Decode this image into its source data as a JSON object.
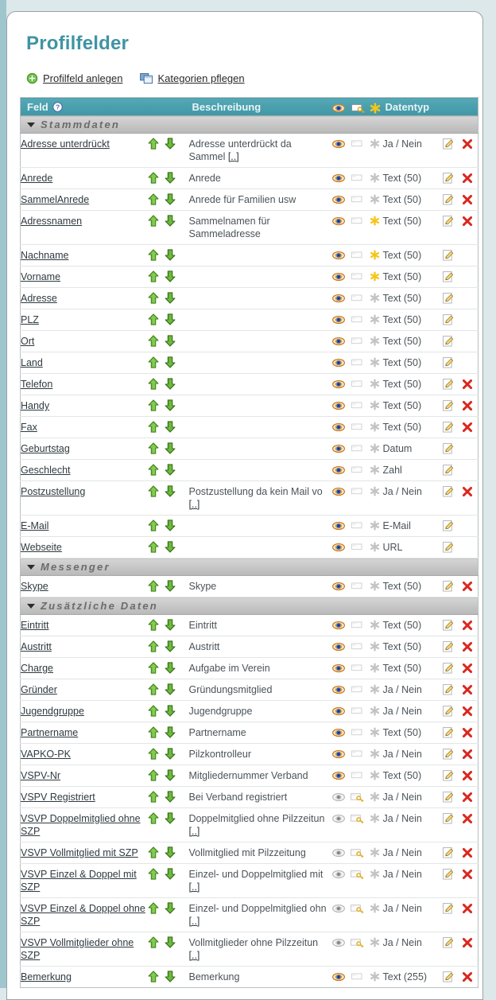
{
  "page": {
    "title": "Profilfelder"
  },
  "actions": [
    {
      "label": "Profilfeld anlegen",
      "icon": "plus-circle-icon"
    },
    {
      "label": "Kategorien pflegen",
      "icon": "categories-icon"
    }
  ],
  "table": {
    "headers": {
      "field": "Feld",
      "help_icon": "help-icon",
      "description": "Beschreibung",
      "visible_icon": "eye-icon",
      "protected_icon": "key-card-icon",
      "required_icon": "asterisk-icon",
      "datatype": "Datentyp"
    },
    "sections": [
      {
        "name": "Stammdaten",
        "rows": [
          {
            "field": "Adresse unterdrückt",
            "description": "Adresse unterdrückt da Sammel",
            "truncated": true,
            "eye": "on",
            "card": "empty",
            "required": false,
            "datatype": "Ja / Nein",
            "edit": true,
            "delete": true
          },
          {
            "field": "Anrede",
            "description": "Anrede",
            "truncated": false,
            "eye": "on",
            "card": "empty",
            "required": false,
            "datatype": "Text (50)",
            "edit": true,
            "delete": true
          },
          {
            "field": "SammelAnrede",
            "description": "Anrede für Familien usw",
            "truncated": false,
            "eye": "on",
            "card": "empty",
            "required": false,
            "datatype": "Text (50)",
            "edit": true,
            "delete": true
          },
          {
            "field": "Adressnamen",
            "description": "Sammelnamen für Sammeladresse",
            "truncated": false,
            "eye": "on",
            "card": "empty",
            "required": true,
            "datatype": "Text (50)",
            "edit": true,
            "delete": true
          },
          {
            "field": "Nachname",
            "description": "",
            "truncated": false,
            "eye": "on",
            "card": "empty",
            "required": true,
            "datatype": "Text (50)",
            "edit": true,
            "delete": false
          },
          {
            "field": "Vorname",
            "description": "",
            "truncated": false,
            "eye": "on",
            "card": "empty",
            "required": true,
            "datatype": "Text (50)",
            "edit": true,
            "delete": false
          },
          {
            "field": "Adresse",
            "description": "",
            "truncated": false,
            "eye": "on",
            "card": "empty",
            "required": false,
            "datatype": "Text (50)",
            "edit": true,
            "delete": false
          },
          {
            "field": "PLZ",
            "description": "",
            "truncated": false,
            "eye": "on",
            "card": "empty",
            "required": false,
            "datatype": "Text (50)",
            "edit": true,
            "delete": false
          },
          {
            "field": "Ort",
            "description": "",
            "truncated": false,
            "eye": "on",
            "card": "empty",
            "required": false,
            "datatype": "Text (50)",
            "edit": true,
            "delete": false
          },
          {
            "field": "Land",
            "description": "",
            "truncated": false,
            "eye": "on",
            "card": "empty",
            "required": false,
            "datatype": "Text (50)",
            "edit": true,
            "delete": false
          },
          {
            "field": "Telefon",
            "description": "",
            "truncated": false,
            "eye": "on",
            "card": "empty",
            "required": false,
            "datatype": "Text (50)",
            "edit": true,
            "delete": true
          },
          {
            "field": "Handy",
            "description": "",
            "truncated": false,
            "eye": "on",
            "card": "empty",
            "required": false,
            "datatype": "Text (50)",
            "edit": true,
            "delete": true
          },
          {
            "field": "Fax",
            "description": "",
            "truncated": false,
            "eye": "on",
            "card": "empty",
            "required": false,
            "datatype": "Text (50)",
            "edit": true,
            "delete": true
          },
          {
            "field": "Geburtstag",
            "description": "",
            "truncated": false,
            "eye": "on",
            "card": "empty",
            "required": false,
            "datatype": "Datum",
            "edit": true,
            "delete": false
          },
          {
            "field": "Geschlecht",
            "description": "",
            "truncated": false,
            "eye": "on",
            "card": "empty",
            "required": false,
            "datatype": "Zahl",
            "edit": true,
            "delete": false
          },
          {
            "field": "Postzustellung",
            "description": "Postzustellung da kein Mail vo",
            "truncated": true,
            "eye": "on",
            "card": "empty",
            "required": false,
            "datatype": "Ja / Nein",
            "edit": true,
            "delete": true
          },
          {
            "field": "E-Mail",
            "description": "",
            "truncated": false,
            "eye": "on",
            "card": "empty",
            "required": false,
            "datatype": "E-Mail",
            "edit": true,
            "delete": false
          },
          {
            "field": "Webseite",
            "description": "",
            "truncated": false,
            "eye": "on",
            "card": "empty",
            "required": false,
            "datatype": "URL",
            "edit": true,
            "delete": false
          }
        ]
      },
      {
        "name": "Messenger",
        "rows": [
          {
            "field": "Skype",
            "description": "Skype",
            "truncated": false,
            "eye": "on",
            "card": "empty",
            "required": false,
            "datatype": "Text (50)",
            "edit": true,
            "delete": true
          }
        ]
      },
      {
        "name": "Zusätzliche Daten",
        "rows": [
          {
            "field": "Eintritt",
            "description": "Eintritt",
            "truncated": false,
            "eye": "on",
            "card": "empty",
            "required": false,
            "datatype": "Text (50)",
            "edit": true,
            "delete": true
          },
          {
            "field": "Austritt",
            "description": "Austritt",
            "truncated": false,
            "eye": "on",
            "card": "empty",
            "required": false,
            "datatype": "Text (50)",
            "edit": true,
            "delete": true
          },
          {
            "field": "Charge",
            "description": "Aufgabe im Verein",
            "truncated": false,
            "eye": "on",
            "card": "empty",
            "required": false,
            "datatype": "Text (50)",
            "edit": true,
            "delete": true
          },
          {
            "field": "Gründer",
            "description": "Gründungsmitglied",
            "truncated": false,
            "eye": "on",
            "card": "empty",
            "required": false,
            "datatype": "Ja / Nein",
            "edit": true,
            "delete": true
          },
          {
            "field": "Jugendgruppe",
            "description": "Jugendgruppe",
            "truncated": false,
            "eye": "on",
            "card": "empty",
            "required": false,
            "datatype": "Ja / Nein",
            "edit": true,
            "delete": true
          },
          {
            "field": "Partnername",
            "description": "Partnername",
            "truncated": false,
            "eye": "on",
            "card": "empty",
            "required": false,
            "datatype": "Text (50)",
            "edit": true,
            "delete": true
          },
          {
            "field": "VAPKO-PK",
            "description": "Pilzkontrolleur",
            "truncated": false,
            "eye": "on",
            "card": "empty",
            "required": false,
            "datatype": "Ja / Nein",
            "edit": true,
            "delete": true
          },
          {
            "field": "VSPV-Nr",
            "description": "Mitgliedernummer Verband",
            "truncated": false,
            "eye": "on",
            "card": "empty",
            "required": false,
            "datatype": "Text (50)",
            "edit": true,
            "delete": true
          },
          {
            "field": "VSPV Registriert",
            "description": "Bei Verband registriert",
            "truncated": false,
            "eye": "off",
            "card": "key",
            "required": false,
            "datatype": "Ja / Nein",
            "edit": true,
            "delete": true
          },
          {
            "field": "VSVP Doppelmitglied ohne SZP",
            "description": "Doppelmitglied ohne Pilzzeitun",
            "truncated": true,
            "eye": "off",
            "card": "key",
            "required": false,
            "datatype": "Ja / Nein",
            "edit": true,
            "delete": true
          },
          {
            "field": "VSVP Vollmitglied mit SZP",
            "description": "Vollmitglied mit Pilzzeitung",
            "truncated": false,
            "eye": "off",
            "card": "key",
            "required": false,
            "datatype": "Ja / Nein",
            "edit": true,
            "delete": true
          },
          {
            "field": "VSVP Einzel & Doppel mit SZP",
            "description": "Einzel- und Doppelmitglied mit",
            "truncated": true,
            "eye": "off",
            "card": "key",
            "required": false,
            "datatype": "Ja / Nein",
            "edit": true,
            "delete": true
          },
          {
            "field": "VSVP Einzel & Doppel ohne SZP",
            "description": "Einzel- und Doppelmitglied ohn",
            "truncated": true,
            "eye": "off",
            "card": "key",
            "required": false,
            "datatype": "Ja / Nein",
            "edit": true,
            "delete": true
          },
          {
            "field": "VSVP Vollmitglieder ohne SZP",
            "description": "Vollmitglieder ohne Pilzzeitun",
            "truncated": true,
            "eye": "off",
            "card": "key",
            "required": false,
            "datatype": "Ja / Nein",
            "edit": true,
            "delete": true
          },
          {
            "field": "Bemerkung",
            "description": "Bemerkung",
            "truncated": false,
            "eye": "on",
            "card": "empty",
            "required": false,
            "datatype": "Text (255)",
            "edit": true,
            "delete": true
          }
        ]
      }
    ],
    "truncation_label": "[..]",
    "move_up_icon": "arrow-up-icon",
    "move_down_icon": "arrow-down-icon",
    "edit_icon": "pencil-icon",
    "delete_icon": "delete-x-icon"
  },
  "colors": {
    "page_background": "#dce8ea",
    "panel_background": "#ffffff",
    "title": "#3f94a3",
    "table_header": "#4a9fad",
    "section_header": "#c6c6c6",
    "required_asterisk": "#f5c518",
    "optional_asterisk": "#bfbfbf",
    "arrow_green": "#5aa832",
    "delete_red": "#d9271e"
  }
}
